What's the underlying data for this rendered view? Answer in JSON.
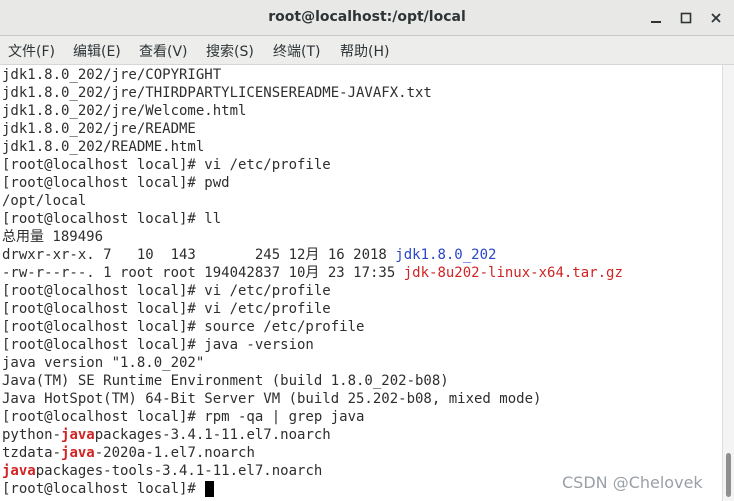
{
  "window": {
    "title": "root@localhost:/opt/local"
  },
  "menu": {
    "items": [
      "文件(F)",
      "编辑(E)",
      "查看(V)",
      "搜索(S)",
      "终端(T)",
      "帮助(H)"
    ]
  },
  "terminal": {
    "lines": [
      "jdk1.8.0_202/jre/COPYRIGHT",
      "jdk1.8.0_202/jre/THIRDPARTYLICENSEREADME-JAVAFX.txt",
      "jdk1.8.0_202/jre/Welcome.html",
      "jdk1.8.0_202/jre/README",
      "jdk1.8.0_202/README.html",
      "[root@localhost local]# vi /etc/profile",
      "[root@localhost local]# pwd",
      "/opt/local",
      "[root@localhost local]# ll",
      "总用量 189496",
      "drwxr-xr-x. 7   10  143       245 12月 16 2018 ",
      "-rw-r--r--. 1 root root 194042837 10月 23 17:35 ",
      "[root@localhost local]# vi /etc/profile",
      "[root@localhost local]# vi /etc/profile",
      "[root@localhost local]# source /etc/profile",
      "[root@localhost local]# java -version",
      "java version \"1.8.0_202\"",
      "Java(TM) SE Runtime Environment (build 1.8.0_202-b08)",
      "Java HotSpot(TM) 64-Bit Server VM (build 25.202-b08, mixed mode)",
      "[root@localhost local]# rpm -qa | grep java",
      "python-",
      "tzdata-",
      "",
      "[root@localhost local]# "
    ],
    "dir_name": "jdk1.8.0_202",
    "archive_name": "jdk-8u202-linux-x64.tar.gz",
    "grep_match": "java",
    "python_rest": "packages-3.4.1-11.el7.noarch",
    "tzdata_rest": "-2020a-1.el7.noarch",
    "javapkg_rest": "packages-tools-3.4.1-11.el7.noarch"
  },
  "watermark": "CSDN @Chelovek",
  "colors": {
    "directory": "#2a46c8",
    "archive": "#d12424",
    "grep_highlight": "#d12424"
  }
}
